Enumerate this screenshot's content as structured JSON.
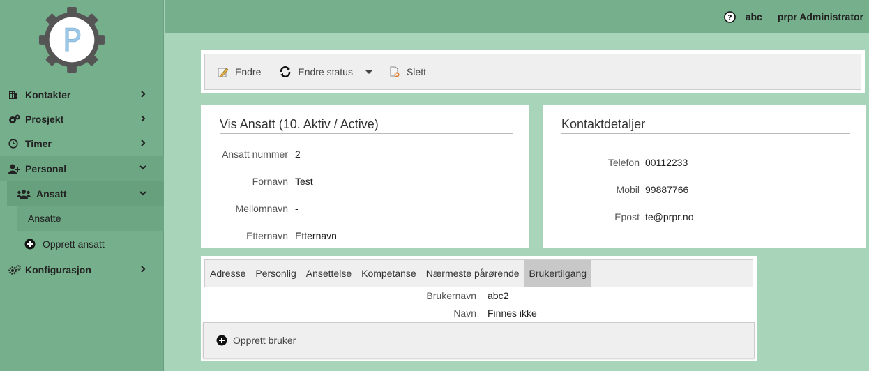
{
  "colors": {
    "sidebar": "#76af8c",
    "background": "#a8d5b9",
    "panel": "#efefef",
    "active_tab": "#c8c8c8"
  },
  "logo": {
    "letter": "P"
  },
  "header": {
    "help_icon": "question-circle-icon",
    "username": "abc",
    "role": "prpr Administrator"
  },
  "sidebar": {
    "items": [
      {
        "label": "Kontakter",
        "icon": "building-icon"
      },
      {
        "label": "Prosjekt",
        "icon": "project-icon"
      },
      {
        "label": "Timer",
        "icon": "clock-icon"
      },
      {
        "label": "Personal",
        "icon": "user-icon"
      },
      {
        "label": "Ansatt",
        "icon": "users-icon"
      },
      {
        "label": "Ansatte"
      },
      {
        "label": "Opprett ansatt",
        "icon": "plus-circle-icon"
      },
      {
        "label": "Konfigurasjon",
        "icon": "gears-icon"
      }
    ]
  },
  "toolbar": {
    "edit_label": "Endre",
    "change_status_label": "Endre status",
    "delete_label": "Slett"
  },
  "employee": {
    "title": "Vis Ansatt (10. Aktiv / Active)",
    "fields": [
      {
        "label": "Ansatt nummer",
        "value": "2"
      },
      {
        "label": "Fornavn",
        "value": "Test"
      },
      {
        "label": "Mellomnavn",
        "value": "-"
      },
      {
        "label": "Etternavn",
        "value": "Etternavn"
      }
    ]
  },
  "contact": {
    "title": "Kontaktdetaljer",
    "fields": [
      {
        "label": "Telefon",
        "value": "00112233"
      },
      {
        "label": "Mobil",
        "value": "99887766"
      },
      {
        "label": "Epost",
        "value": "te@prpr.no"
      }
    ]
  },
  "tabs": [
    {
      "label": "Adresse"
    },
    {
      "label": "Personlig"
    },
    {
      "label": "Ansettelse"
    },
    {
      "label": "Kompetanse"
    },
    {
      "label": "Nærmeste pårørende"
    },
    {
      "label": "Brukertilgang",
      "active": true
    }
  ],
  "user_access": {
    "fields": [
      {
        "label": "Brukernavn",
        "value": "abc2"
      },
      {
        "label": "Navn",
        "value": "Finnes ikke"
      }
    ],
    "create_user_label": "Opprett bruker"
  }
}
